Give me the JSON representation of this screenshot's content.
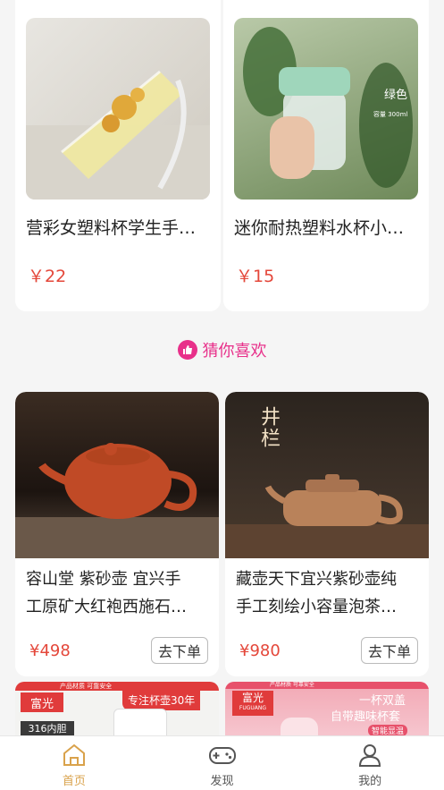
{
  "top_products": [
    {
      "title": "营彩女塑料杯学生手…",
      "price": "￥22"
    },
    {
      "title": "迷你耐热塑料水杯小…",
      "price": "￥15"
    }
  ],
  "recommend": {
    "title": "猜你喜欢",
    "items": [
      {
        "title_line1": "容山堂 紫砂壶 宜兴手",
        "title_line2": "工原矿大红袍西施石…",
        "price": "¥498",
        "button": "去下单",
        "image_text": ""
      },
      {
        "title_line1": "藏壶天下宜兴紫砂壶纯",
        "title_line2": "手工刻绘小容量泡茶…",
        "price": "¥980",
        "button": "去下单",
        "image_text": "井栏"
      }
    ]
  },
  "banners": [
    {
      "brand": "富光",
      "tag_top": "产品材质  可靠安全",
      "slogan": "专注杯壶30年",
      "badge": "316内胆"
    },
    {
      "brand": "富光",
      "brand_en": "FUGUANG",
      "tag_top": "产品材质  可靠安全",
      "slogan1": "一杯双盖",
      "slogan2": "自带趣味杯套",
      "badge": "智能显温"
    }
  ],
  "bottle_text": {
    "main": "绿色",
    "sub": "容量 300ml"
  },
  "tabbar": [
    {
      "label": "首页",
      "icon": "home-icon",
      "active": true
    },
    {
      "label": "发现",
      "icon": "gamepad-icon",
      "active": false
    },
    {
      "label": "我的",
      "icon": "user-icon",
      "active": false
    }
  ],
  "colors": {
    "price": "#e4473a",
    "accent": "#e8308a",
    "tab_active": "#d9a24b"
  }
}
